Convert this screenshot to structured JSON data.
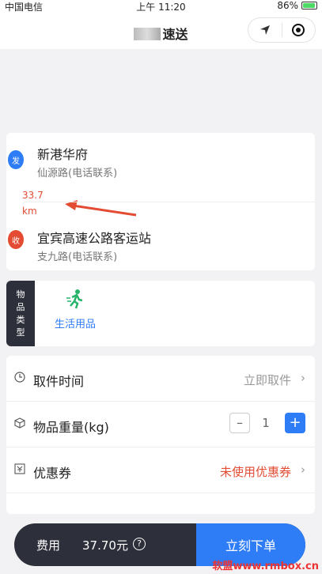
{
  "status_bar": {
    "carrier": "中国电信",
    "time": "上午 11:20",
    "battery": "86%"
  },
  "nav": {
    "title": "速送",
    "location_icon": "location-arrow-icon",
    "target_icon": "target-icon"
  },
  "route": {
    "start": {
      "name": "新港华府",
      "sub": "仙源路(电话联系)",
      "pin_label": "发"
    },
    "end": {
      "name": "宜宾高速公路客运站",
      "sub": "支九路(电话联系)",
      "pin_label": "收"
    },
    "distance": "33.7",
    "distance_unit": "km"
  },
  "goods": {
    "tag_chars": [
      "物",
      "品",
      "类",
      "型"
    ],
    "selected_label": "生活用品",
    "icon": "running-person-icon"
  },
  "options": {
    "pickup_time": {
      "label": "取件时间",
      "value": "立即取件"
    },
    "weight": {
      "label": "物品重量(kg)",
      "minus": "–",
      "value": "1",
      "plus": "+"
    },
    "coupon": {
      "label": "优惠券",
      "value": "未使用优惠券"
    }
  },
  "footer": {
    "fee_label": "费用",
    "fee_amount": "37.70元",
    "help": "?",
    "order_button": "立刻下单"
  },
  "watermark": "软盟www.rmbox.cn",
  "colors": {
    "accent": "#2f7df6",
    "red": "#e34b32",
    "dark": "#2d2f3a",
    "green": "#28b36b"
  }
}
